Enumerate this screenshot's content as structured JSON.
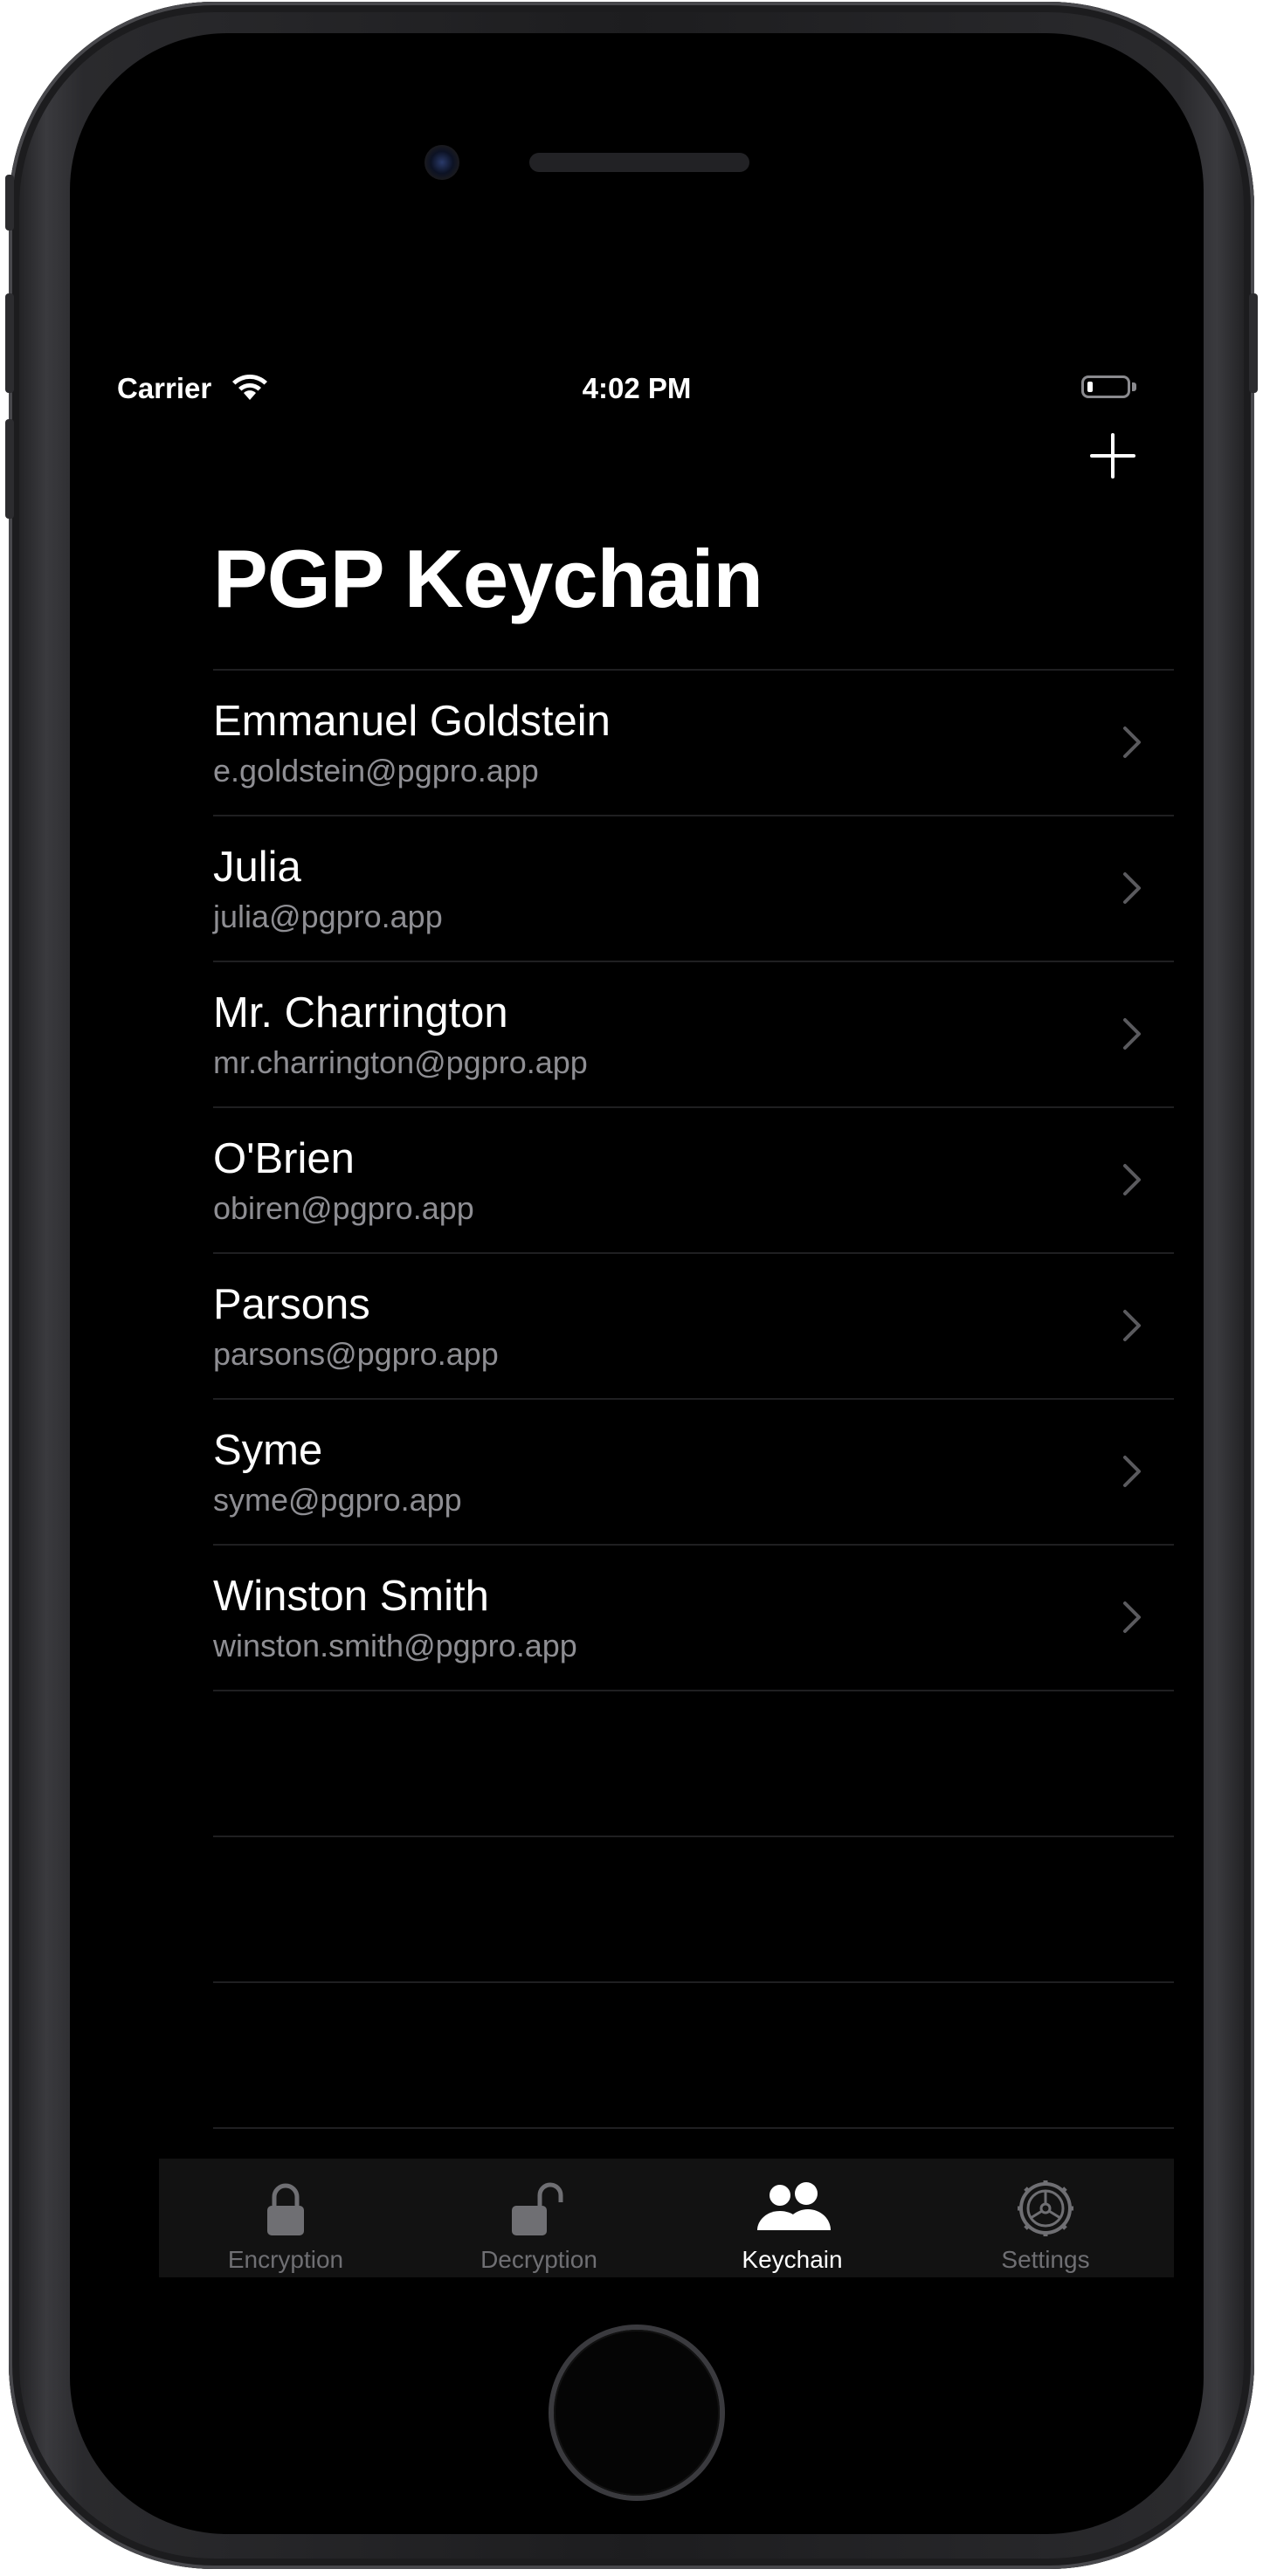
{
  "status_bar": {
    "carrier": "Carrier",
    "time": "4:02 PM",
    "battery_level": 0.15
  },
  "nav": {
    "add_icon": "plus-icon",
    "title": "PGP Keychain"
  },
  "contacts": [
    {
      "name": "Emmanuel Goldstein",
      "email": "e.goldstein@pgpro.app"
    },
    {
      "name": "Julia",
      "email": "julia@pgpro.app"
    },
    {
      "name": "Mr. Charrington",
      "email": "mr.charrington@pgpro.app"
    },
    {
      "name": "O'Brien",
      "email": "obiren@pgpro.app"
    },
    {
      "name": "Parsons",
      "email": "parsons@pgpro.app"
    },
    {
      "name": "Syme",
      "email": "syme@pgpro.app"
    },
    {
      "name": "Winston Smith",
      "email": "winston.smith@pgpro.app"
    }
  ],
  "tabs": [
    {
      "label": "Encryption",
      "icon": "lock-icon",
      "active": false
    },
    {
      "label": "Decryption",
      "icon": "unlock-icon",
      "active": false
    },
    {
      "label": "Keychain",
      "icon": "people-icon",
      "active": true
    },
    {
      "label": "Settings",
      "icon": "gear-icon",
      "active": false
    }
  ],
  "colors": {
    "background": "#000000",
    "text_primary": "#ffffff",
    "text_secondary": "#8e8e93",
    "tab_inactive": "#6f6f73",
    "tab_bar": "#121212",
    "separator": "#1f1f21"
  }
}
